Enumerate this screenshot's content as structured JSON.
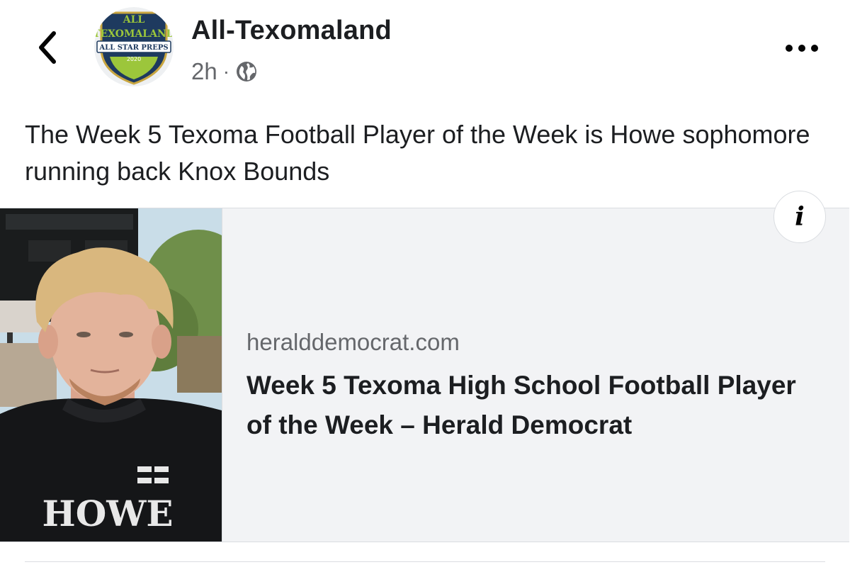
{
  "header": {
    "page_name": "All-Texomaland",
    "timestamp": "2h",
    "separator": "·",
    "privacy_icon": "globe-icon",
    "back_icon": "chevron-left-icon",
    "more_icon": "more-horizontal-icon",
    "avatar": {
      "line1": "ALL",
      "line2": "TEXOMALAND",
      "banner": "ALL STAR PREPS",
      "year": "2020",
      "colors": {
        "shield": "#1e3a5f",
        "accent": "#9cc63b",
        "gold": "#c9a640"
      }
    }
  },
  "post": {
    "text": "The Week 5 Texoma Football Player of the Week is Howe sophomore running back Knox Bounds"
  },
  "link_preview": {
    "domain": "heralddemocrat.com",
    "title": "Week 5 Texoma High School Football Player of the Week – Herald Democrat",
    "info_icon": "info-icon",
    "info_glyph": "i",
    "thumbnail": {
      "jersey_text": "HOWE",
      "colors": {
        "sky": "#c9dde8",
        "foliage": "#6f8f4a",
        "hair": "#d9b77e",
        "skin": "#e3b39b",
        "jersey": "#151618"
      }
    }
  },
  "colors": {
    "text": "#1c1e21",
    "secondary": "#65676b",
    "card_bg": "#f2f3f5",
    "border": "#dadde1"
  }
}
